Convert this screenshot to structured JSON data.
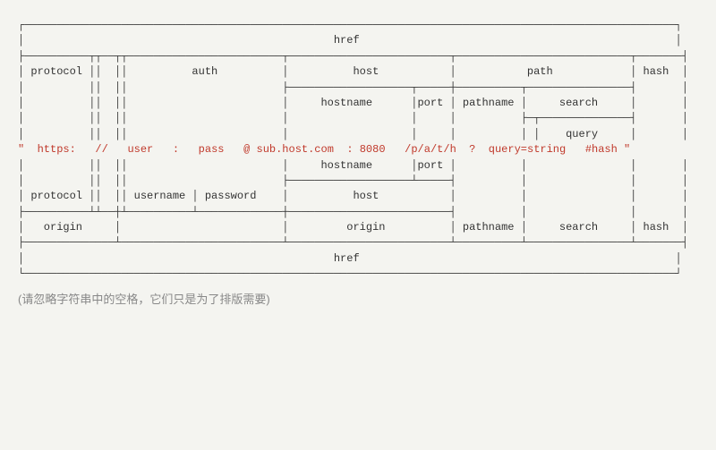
{
  "rows": {
    "r1": "┌─────────────────────────────────────────────────────────────────────────────────────────────────────┐",
    "r2_l": "│                                                ",
    "r2_c": "href",
    "r2_r": "                                                 │",
    "r3": "├──────────┬┬──┬┬────────────────────────┬─────────────────────────┬───────────────────────────┬───────┤",
    "r4": "│ protocol ││  ││          auth          │          host           │           path            │ hash  │",
    "r5": "│          ││  ││                        ├───────────────────┬─────┼──────────┬────────────────┤       │",
    "r6": "│          ││  ││                        │     hostname      │port │ pathname │     search     │       │",
    "r7": "│          ││  ││                        │                   │     │          ├─┬──────────────┤       │",
    "r8": "│          ││  ││                        │                   │     │          │ │    query     │       │",
    "r9_l": "\"  ",
    "r9_a": "https:",
    "r9_b": "   //   ",
    "r9_c": "user",
    "r9_d": "   :   ",
    "r9_e": "pass",
    "r9_f": "   @ ",
    "r9_g": "sub.host.com",
    "r9_h": "  : ",
    "r9_i": "8080",
    "r9_j": "   ",
    "r9_k": "/p/a/t/h",
    "r9_l2": "  ?  ",
    "r9_m": "query=string",
    "r9_n": "   ",
    "r9_o": "#hash",
    "r9_r": " \"",
    "r10": "│          ││  ││                        │     hostname      │port │          │                │       │",
    "r11": "│          ││  ││                        ├───────────────────┴─────┤          │                │       │",
    "r12": "│ protocol ││  ││ username │ password    │          host           │          │                │       │",
    "r13": "├──────────┴┴──┼┴──────────┴─────────────┼─────────────────────────┤          │                │       │",
    "r14": "│   origin     │                         │         origin          │ pathname │     search     │ hash  │",
    "r15": "├──────────────┴─────────────────────────┴─────────────────────────┴──────────┴────────────────┴───────┤",
    "r16_l": "│                                                ",
    "r16_c": "href",
    "r16_r": "                                                 │",
    "r17": "└─────────────────────────────────────────────────────────────────────────────────────────────────────┘"
  },
  "url_parts": {
    "protocol": "https:",
    "slashes": "//",
    "user": "user",
    "colon1": ":",
    "pass": "pass",
    "at": "@",
    "hostname": "sub.host.com",
    "colon2": ":",
    "port": "8080",
    "pathname": "/p/a/t/h",
    "qmark": "?",
    "query": "query=string",
    "hash": "#hash"
  },
  "labels": {
    "href": "href",
    "protocol": "protocol",
    "auth": "auth",
    "host": "host",
    "path": "path",
    "hash": "hash",
    "hostname": "hostname",
    "port": "port",
    "pathname": "pathname",
    "search": "search",
    "query": "query",
    "username": "username",
    "password": "password",
    "origin": "origin"
  },
  "footnote": "(请忽略字符串中的空格，它们只是为了排版需要)"
}
